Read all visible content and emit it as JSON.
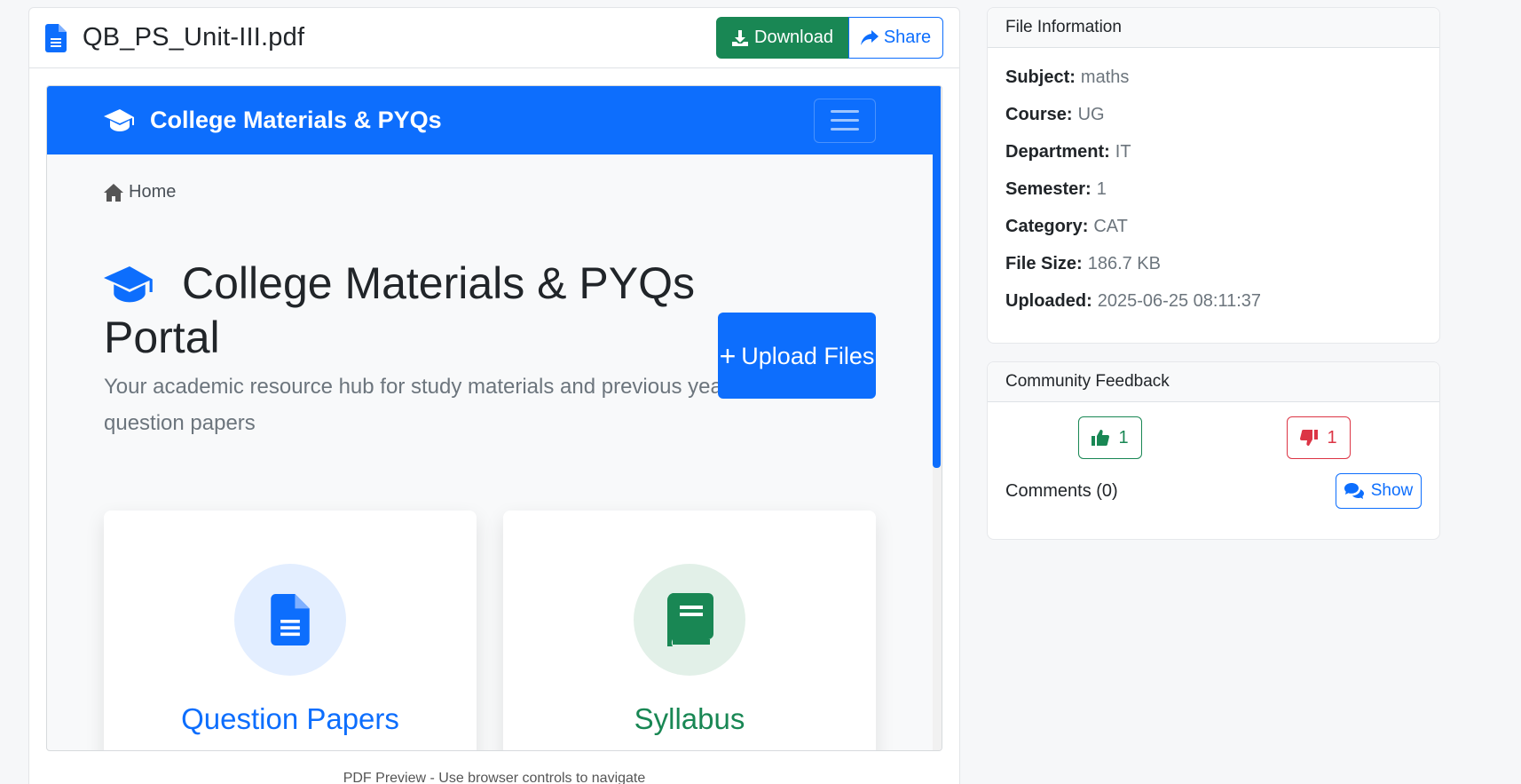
{
  "header": {
    "file_name": "QB_PS_Unit-III.pdf",
    "download_label": "Download",
    "share_label": "Share"
  },
  "preview": {
    "brand": "College Materials & PYQs",
    "breadcrumb_home": "Home",
    "hero_title": "College Materials & PYQs Portal",
    "hero_subtitle": "Your academic resource hub for study materials and previous year question papers",
    "upload_label": "Upload Files",
    "cards": [
      {
        "title": "Question Papers",
        "icon": "file-lines-icon",
        "color": "#0d6efd"
      },
      {
        "title": "Syllabus",
        "icon": "book-icon",
        "color": "#198754"
      }
    ],
    "caption": "PDF Preview - Use browser controls to navigate"
  },
  "file_info": {
    "heading": "File Information",
    "rows": [
      {
        "label": "Subject:",
        "value": "maths"
      },
      {
        "label": "Course:",
        "value": "UG"
      },
      {
        "label": "Department:",
        "value": "IT"
      },
      {
        "label": "Semester:",
        "value": "1"
      },
      {
        "label": "Category:",
        "value": "CAT"
      },
      {
        "label": "File Size:",
        "value": "186.7 KB"
      },
      {
        "label": "Uploaded:",
        "value": "2025-06-25 08:11:37"
      }
    ]
  },
  "feedback": {
    "heading": "Community Feedback",
    "likes": "1",
    "dislikes": "1",
    "comments_label": "Comments (0)",
    "show_label": "Show"
  },
  "colors": {
    "primary": "#0d6efd",
    "success": "#198754",
    "danger": "#dc3545"
  }
}
